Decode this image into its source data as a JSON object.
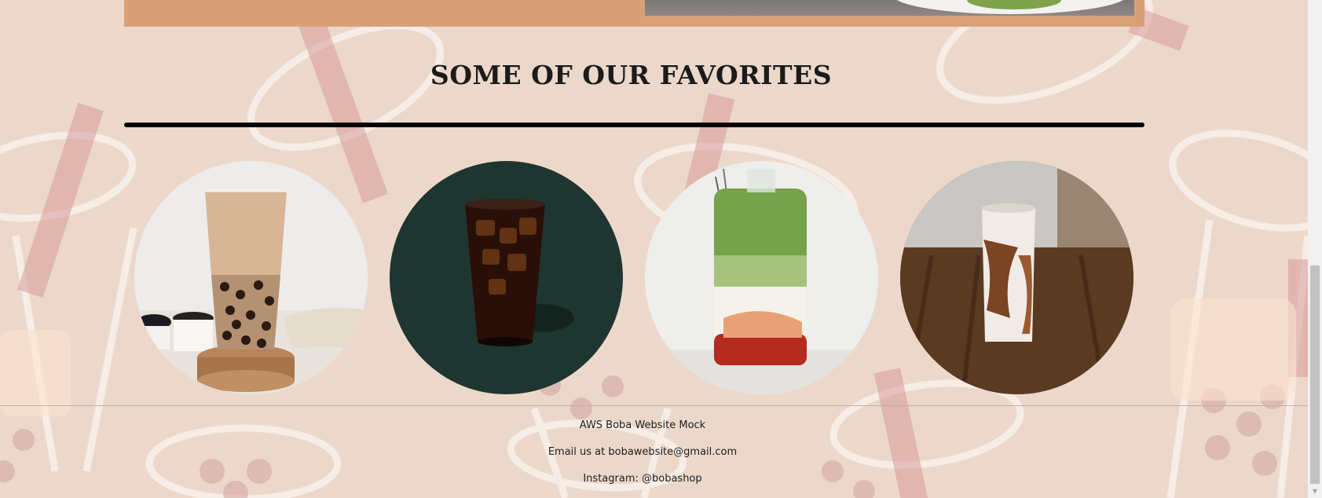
{
  "favorites": {
    "heading": "SOME OF OUR FAVORITES",
    "items": [
      {
        "icon": "milk-tea-boba-image"
      },
      {
        "icon": "iced-coffee-image"
      },
      {
        "icon": "strawberry-matcha-latte-image"
      },
      {
        "icon": "iced-mocha-latte-image"
      }
    ]
  },
  "footer": {
    "site_name": "AWS Boba Website Mock",
    "email_line": "Email us at bobawebsite@gmail.com",
    "instagram_line": "Instagram: @bobashop"
  },
  "colors": {
    "background": "#ecd8cb",
    "banner": "#d9a077",
    "heading_text": "#1b1b1b",
    "rule": "#000000"
  }
}
